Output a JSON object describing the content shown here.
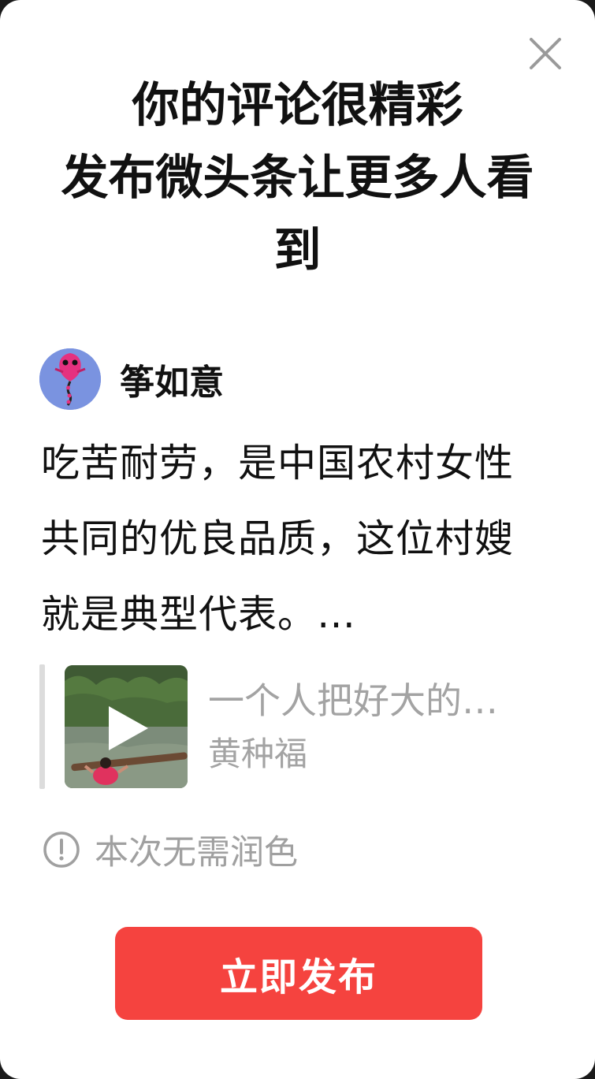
{
  "dialog": {
    "title_line1": "你的评论很精彩",
    "title_line2": "发布微头条让更多人看",
    "title_line3": "到",
    "close_icon": "close-icon"
  },
  "author": {
    "name": "筝如意",
    "avatar_icon": "kite-avatar"
  },
  "comment": {
    "text": "吃苦耐劳，是中国农村女性共同的优良品质，这位村嫂就是典型代表。…"
  },
  "quoted_post": {
    "title": "一个人把好大的…",
    "source": "黄种福",
    "thumbnail_icon": "play-icon"
  },
  "note": {
    "icon": "info-icon",
    "text": "本次无需润色"
  },
  "actions": {
    "publish_label": "立即发布"
  },
  "colors": {
    "accent": "#f5433f",
    "secondary_text": "#a3a3a3",
    "primary_text": "#111111"
  }
}
